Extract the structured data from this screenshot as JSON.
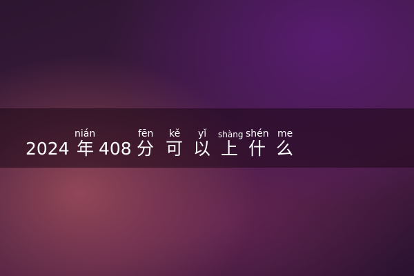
{
  "title": {
    "year": "2024",
    "year_char": "年",
    "score": "408",
    "score_char": "分",
    "ke": "可",
    "yi": "以",
    "shang": "上",
    "shen": "什",
    "me": "么"
  },
  "pinyin": {
    "year_char": "nián",
    "score_char": "fēn",
    "ke": "kě",
    "yi": "yǐ",
    "shang": "shàng",
    "shen": "shén",
    "me": "me"
  }
}
